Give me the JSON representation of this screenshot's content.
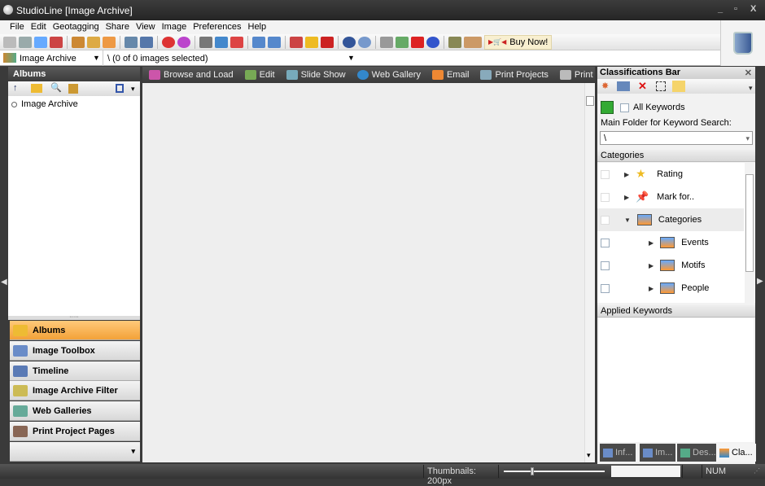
{
  "window": {
    "title": "StudioLine [Image Archive]",
    "controls": [
      "_",
      "▫",
      "X"
    ]
  },
  "menu": [
    "File",
    "Edit",
    "Geotagging",
    "Share",
    "View",
    "Image",
    "Preferences",
    "Help"
  ],
  "toolbar": {
    "buy_now": "Buy Now!"
  },
  "address": {
    "archive": "Image Archive",
    "path": "\\ (0 of 0 images selected)"
  },
  "left_panel": {
    "title": "Albums",
    "tree": [
      {
        "label": "Image Archive"
      }
    ],
    "nav": [
      {
        "label": "Albums",
        "active": true
      },
      {
        "label": "Image Toolbox"
      },
      {
        "label": "Timeline"
      },
      {
        "label": "Image Archive Filter"
      },
      {
        "label": "Web Galleries"
      },
      {
        "label": "Print Project Pages"
      }
    ]
  },
  "center_toolbar": [
    "Browse and Load",
    "Edit",
    "Slide Show",
    "Web Gallery",
    "Email",
    "Print Projects",
    "Print"
  ],
  "right_panel": {
    "title": "Classifications Bar",
    "all_keywords": "All Keywords",
    "all_keywords_checked": false,
    "folder_label": "Main Folder for Keyword Search:",
    "folder_value": "\\",
    "categories_header": "Categories",
    "categories": [
      {
        "label": "Rating",
        "expanded": false
      },
      {
        "label": "Mark for..",
        "expanded": false
      },
      {
        "label": "Categories",
        "expanded": true
      },
      {
        "label": "Events",
        "expanded": false
      },
      {
        "label": "Motifs",
        "expanded": false
      },
      {
        "label": "People",
        "expanded": false
      }
    ],
    "applied_header": "Applied Keywords",
    "tabs": [
      {
        "label": "Inf..."
      },
      {
        "label": "Im..."
      },
      {
        "label": "Des..."
      },
      {
        "label": "Cla...",
        "active": true
      }
    ]
  },
  "status": {
    "thumbnails": "Thumbnails: 200px",
    "slider_fraction": 0.28,
    "num": "NUM"
  },
  "colors": {
    "accent": "#f3a238",
    "dark": "#3a3a3a"
  }
}
